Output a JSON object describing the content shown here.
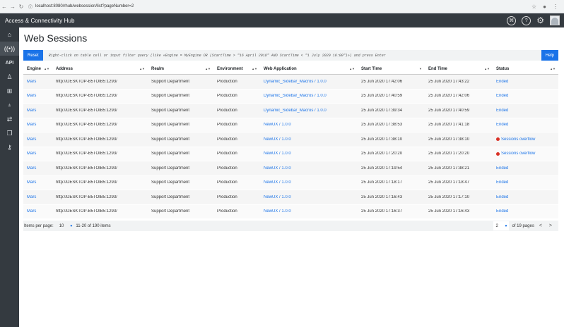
{
  "browser": {
    "url": "localhost:8080/rhub/websession/list?pageNumber=2"
  },
  "app": {
    "title": "Access & Connectivity Hub"
  },
  "sidebar": {
    "items": [
      {
        "name": "home-icon",
        "glyph": "⌂"
      },
      {
        "name": "broadcast-icon",
        "glyph": "((•))"
      },
      {
        "name": "api-icon",
        "glyph": "API"
      },
      {
        "name": "user-icon",
        "glyph": "♙"
      },
      {
        "name": "network-icon",
        "glyph": "⊞"
      },
      {
        "name": "globe-icon",
        "glyph": "♁"
      },
      {
        "name": "route-icon",
        "glyph": "⇄"
      },
      {
        "name": "copy-icon",
        "glyph": "❐"
      },
      {
        "name": "key-icon",
        "glyph": "⚷"
      }
    ]
  },
  "page": {
    "title": "Web Sessions"
  },
  "toolbar": {
    "reset_label": "Reset",
    "filter_hint": "Right-click on table cell or input filter query (like «Engine = MyEngine OR (StartTime > \"16 April 2018\" AND StartTime < \"1 July 2020 16:00\")») and press Enter",
    "help_label": "Help"
  },
  "table": {
    "columns": [
      "Engine",
      "Address",
      "Realm",
      "Environment",
      "Web Application",
      "Start Time",
      "End Time",
      "Status"
    ],
    "rows": [
      {
        "engine": "Mars",
        "address": "http://DESKTOP-B5TOIB5:1293/",
        "realm": "Support Department",
        "env": "Production",
        "app": "Dynamic_Sidebar_Macros / 1.0.0",
        "start": "25 Jun 2020 17:42:06",
        "end": "25 Jun 2020 17:43:22",
        "status": "Ended",
        "error": false
      },
      {
        "engine": "Mars",
        "address": "http://DESKTOP-B5TOIB5:1293/",
        "realm": "Support Department",
        "env": "Production",
        "app": "Dynamic_Sidebar_Macros / 1.0.0",
        "start": "25 Jun 2020 17:40:59",
        "end": "25 Jun 2020 17:42:06",
        "status": "Ended",
        "error": false
      },
      {
        "engine": "Mars",
        "address": "http://DESKTOP-B5TOIB5:1293/",
        "realm": "Support Department",
        "env": "Production",
        "app": "Dynamic_Sidebar_Macros / 1.0.0",
        "start": "25 Jun 2020 17:39:34",
        "end": "25 Jun 2020 17:40:59",
        "status": "Ended",
        "error": false
      },
      {
        "engine": "Mars",
        "address": "http://DESKTOP-B5TOIB5:1293/",
        "realm": "Support Department",
        "env": "Production",
        "app": "NewUX / 1.0.0",
        "start": "25 Jun 2020 17:38:53",
        "end": "25 Jun 2020 17:41:18",
        "status": "Ended",
        "error": false
      },
      {
        "engine": "Mars",
        "address": "http://DESKTOP-B5TOIB5:1293/",
        "realm": "Support Department",
        "env": "Production",
        "app": "NewUX / 1.0.0",
        "start": "25 Jun 2020 17:38:10",
        "end": "25 Jun 2020 17:38:10",
        "status": "Sessions overflow",
        "error": true
      },
      {
        "engine": "Mars",
        "address": "http://DESKTOP-B5TOIB5:1293/",
        "realm": "Support Department",
        "env": "Production",
        "app": "NewUX / 1.0.0",
        "start": "25 Jun 2020 17:20:20",
        "end": "25 Jun 2020 17:20:20",
        "status": "Sessions overflow",
        "error": true
      },
      {
        "engine": "Mars",
        "address": "http://DESKTOP-B5TOIB5:1293/",
        "realm": "Support Department",
        "env": "Production",
        "app": "NewUX / 1.0.0",
        "start": "25 Jun 2020 17:19:54",
        "end": "25 Jun 2020 17:38:21",
        "status": "Ended",
        "error": false
      },
      {
        "engine": "Mars",
        "address": "http://DESKTOP-B5TOIB5:1293/",
        "realm": "Support Department",
        "env": "Production",
        "app": "NewUX / 1.0.0",
        "start": "25 Jun 2020 17:18:17",
        "end": "25 Jun 2020 17:18:47",
        "status": "Ended",
        "error": false
      },
      {
        "engine": "Mars",
        "address": "http://DESKTOP-B5TOIB5:1293/",
        "realm": "Support Department",
        "env": "Production",
        "app": "NewUX / 1.0.0",
        "start": "25 Jun 2020 17:16:43",
        "end": "25 Jun 2020 17:17:10",
        "status": "Ended",
        "error": false
      },
      {
        "engine": "Mars",
        "address": "http://DESKTOP-B5TOIB5:1293/",
        "realm": "Support Department",
        "env": "Production",
        "app": "NewUX / 1.0.0",
        "start": "25 Jun 2020 17:16:37",
        "end": "25 Jun 2020 17:16:43",
        "status": "Ended",
        "error": false
      }
    ]
  },
  "footer": {
    "items_per_page_label": "Items per page:",
    "items_per_page_value": "10",
    "range_label": "11-20 of 190 items",
    "current_page": "2",
    "pages_label": "of 19 pages",
    "prev": "<",
    "next": ">"
  },
  "colors": {
    "accent": "#1a73e8",
    "appbar": "#343a40",
    "error": "#d93025"
  }
}
